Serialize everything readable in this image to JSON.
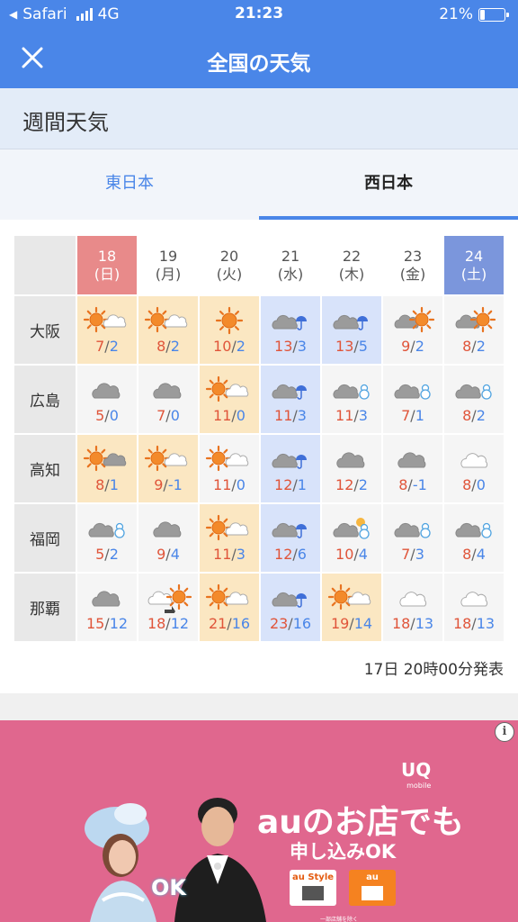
{
  "status_bar": {
    "back_app": "Safari",
    "network": "4G",
    "time": "21:23",
    "battery": "21%",
    "battery_level": 0.21
  },
  "nav": {
    "title": "全国の天気",
    "close_icon": "close-icon"
  },
  "section": {
    "title": "週間天気"
  },
  "tabs": [
    {
      "label": "東日本",
      "active": false
    },
    {
      "label": "西日本",
      "active": true
    }
  ],
  "days": [
    {
      "date": "18",
      "weekday": "(日)",
      "type": "sun"
    },
    {
      "date": "19",
      "weekday": "(月)",
      "type": "normal"
    },
    {
      "date": "20",
      "weekday": "(火)",
      "type": "normal"
    },
    {
      "date": "21",
      "weekday": "(水)",
      "type": "normal"
    },
    {
      "date": "22",
      "weekday": "(木)",
      "type": "normal"
    },
    {
      "date": "23",
      "weekday": "(金)",
      "type": "normal"
    },
    {
      "date": "24",
      "weekday": "(土)",
      "type": "sat"
    }
  ],
  "cities": [
    {
      "name": "大阪",
      "forecast": [
        {
          "icon": "sun-cloud",
          "hi": "7",
          "lo": "2",
          "bg": "sunny"
        },
        {
          "icon": "sun-cloud",
          "hi": "8",
          "lo": "2",
          "bg": "sunny"
        },
        {
          "icon": "sun",
          "hi": "10",
          "lo": "2",
          "bg": "sunny"
        },
        {
          "icon": "cloud-rain",
          "hi": "13",
          "lo": "3",
          "bg": "rainy"
        },
        {
          "icon": "cloud-rain",
          "hi": "13",
          "lo": "5",
          "bg": "rainy"
        },
        {
          "icon": "cloud-sun",
          "hi": "9",
          "lo": "2",
          "bg": "none"
        },
        {
          "icon": "cloud-sun",
          "hi": "8",
          "lo": "2",
          "bg": "none"
        }
      ]
    },
    {
      "name": "広島",
      "forecast": [
        {
          "icon": "cloud",
          "hi": "5",
          "lo": "0",
          "bg": "none"
        },
        {
          "icon": "cloud",
          "hi": "7",
          "lo": "0",
          "bg": "none"
        },
        {
          "icon": "sun-cloud",
          "hi": "11",
          "lo": "0",
          "bg": "sunny"
        },
        {
          "icon": "cloud-rain",
          "hi": "11",
          "lo": "3",
          "bg": "rainy"
        },
        {
          "icon": "cloud-snow",
          "hi": "11",
          "lo": "3",
          "bg": "none"
        },
        {
          "icon": "cloud-snow",
          "hi": "7",
          "lo": "1",
          "bg": "none"
        },
        {
          "icon": "cloud-snow",
          "hi": "8",
          "lo": "2",
          "bg": "none"
        }
      ]
    },
    {
      "name": "高知",
      "forecast": [
        {
          "icon": "sun-cloud-dark",
          "hi": "8",
          "lo": "1",
          "bg": "sunny"
        },
        {
          "icon": "sun-cloud",
          "hi": "9",
          "lo": "-1",
          "bg": "sunny"
        },
        {
          "icon": "sun-cloud",
          "hi": "11",
          "lo": "0",
          "bg": "none"
        },
        {
          "icon": "cloud-rain",
          "hi": "12",
          "lo": "1",
          "bg": "rainy"
        },
        {
          "icon": "cloud",
          "hi": "12",
          "lo": "2",
          "bg": "none"
        },
        {
          "icon": "cloud",
          "hi": "8",
          "lo": "-1",
          "bg": "none"
        },
        {
          "icon": "cloud-light",
          "hi": "8",
          "lo": "0",
          "bg": "none"
        }
      ]
    },
    {
      "name": "福岡",
      "forecast": [
        {
          "icon": "cloud-snow",
          "hi": "5",
          "lo": "2",
          "bg": "none"
        },
        {
          "icon": "cloud",
          "hi": "9",
          "lo": "4",
          "bg": "none"
        },
        {
          "icon": "sun-cloud",
          "hi": "11",
          "lo": "3",
          "bg": "sunny"
        },
        {
          "icon": "cloud-rain",
          "hi": "12",
          "lo": "6",
          "bg": "rainy"
        },
        {
          "icon": "cloud-snow-sun",
          "hi": "10",
          "lo": "4",
          "bg": "none"
        },
        {
          "icon": "cloud-snow",
          "hi": "7",
          "lo": "3",
          "bg": "none"
        },
        {
          "icon": "cloud-snow",
          "hi": "8",
          "lo": "4",
          "bg": "none"
        }
      ]
    },
    {
      "name": "那覇",
      "forecast": [
        {
          "icon": "cloud",
          "hi": "15",
          "lo": "12",
          "bg": "none"
        },
        {
          "icon": "cloud-sun-turn",
          "hi": "18",
          "lo": "12",
          "bg": "none"
        },
        {
          "icon": "sun-cloud",
          "hi": "21",
          "lo": "16",
          "bg": "sunny"
        },
        {
          "icon": "cloud-rain",
          "hi": "23",
          "lo": "16",
          "bg": "rainy"
        },
        {
          "icon": "sun-cloud",
          "hi": "19",
          "lo": "14",
          "bg": "sunny"
        },
        {
          "icon": "cloud-light",
          "hi": "18",
          "lo": "13",
          "bg": "none"
        },
        {
          "icon": "cloud-light",
          "hi": "18",
          "lo": "13",
          "bg": "none"
        }
      ]
    }
  ],
  "announcement": "17日 20時00分発表",
  "ad": {
    "brand": "UQ",
    "brand_sub": "mobile",
    "headline": "auのお店でも",
    "subline": "申し込みOK",
    "store1": "au Style",
    "store2": "au",
    "fine_print": "一部店舗を除く",
    "ok_text": "OK"
  },
  "colors": {
    "primary": "#4a86e8",
    "sunday": "#e88a8a",
    "saturday": "#7b96dc",
    "sunny_bg": "#fbe7c2",
    "rainy_bg": "#d8e3fa",
    "temp_hi": "#e0553a",
    "temp_lo": "#4a86e8",
    "ad_bg": "#e0678e"
  }
}
